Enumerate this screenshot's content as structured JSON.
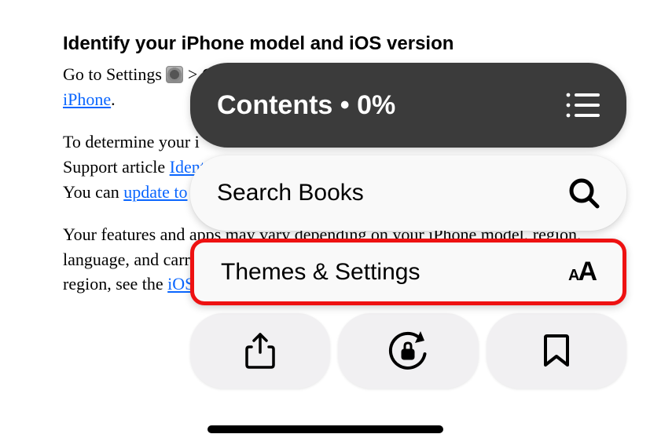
{
  "heading": "Identify your iPhone model and iOS version",
  "intro_before_icon": "Go to Settings ",
  "intro_after_icon": " > General > About. See ",
  "intro_link_label": "Get information about your iPhone",
  "intro_period": ".",
  "para2_a": "To determine your i",
  "para2_b": "Support article ",
  "para2_link": "Identi",
  "para3_a": "You can ",
  "para3_link": "update to ",
  "para4_a": "Your features and apps may vary depending on your iPhone model, region, language, and carri",
  "para4_b": "region, see the ",
  "para4_link": "iOS",
  "panel": {
    "contents_label": "Contents  •  0%",
    "search_label": "Search Books",
    "themes_label": "Themes & Settings"
  }
}
